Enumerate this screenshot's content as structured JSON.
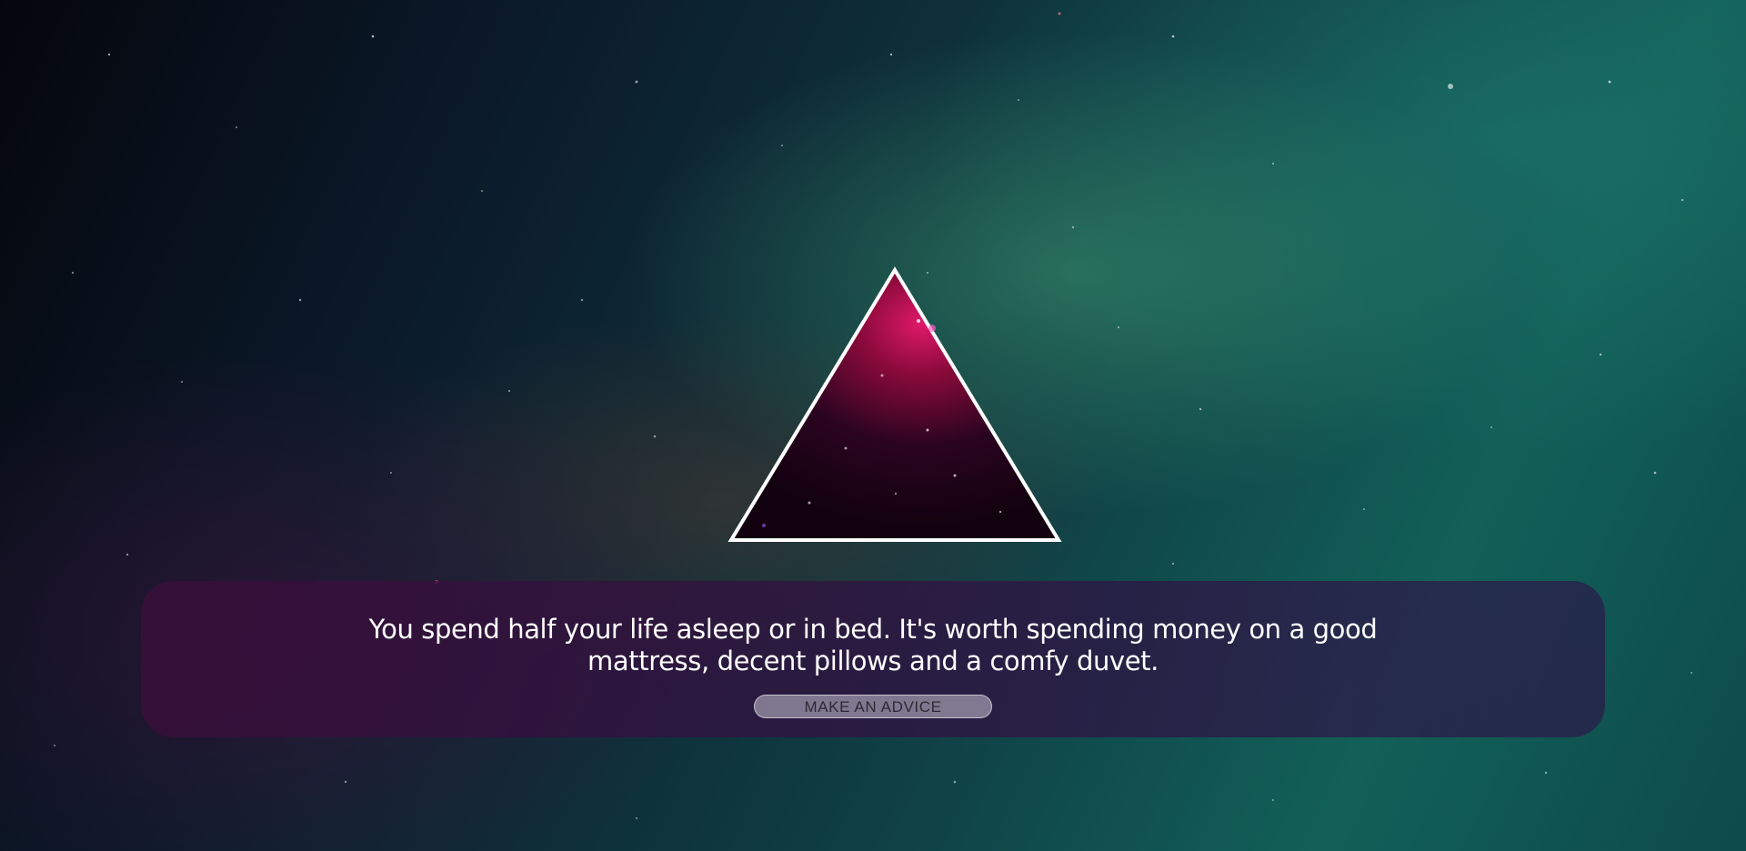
{
  "advice": {
    "text": "You spend half your life asleep or in bed. It's worth spending money on a good mattress, decent pillows and a comfy duvet.",
    "button_label": "MAKE AN ADVICE"
  },
  "logo": {
    "shape": "triangle",
    "icon_name": "triangle-galaxy-logo",
    "outline_color": "#ffffff",
    "fill_colors": [
      "#1a0218",
      "#c01048"
    ]
  },
  "background": {
    "icon_name": "galaxy-background",
    "colors": [
      "#05060d",
      "#0f3a42",
      "#126058"
    ]
  }
}
